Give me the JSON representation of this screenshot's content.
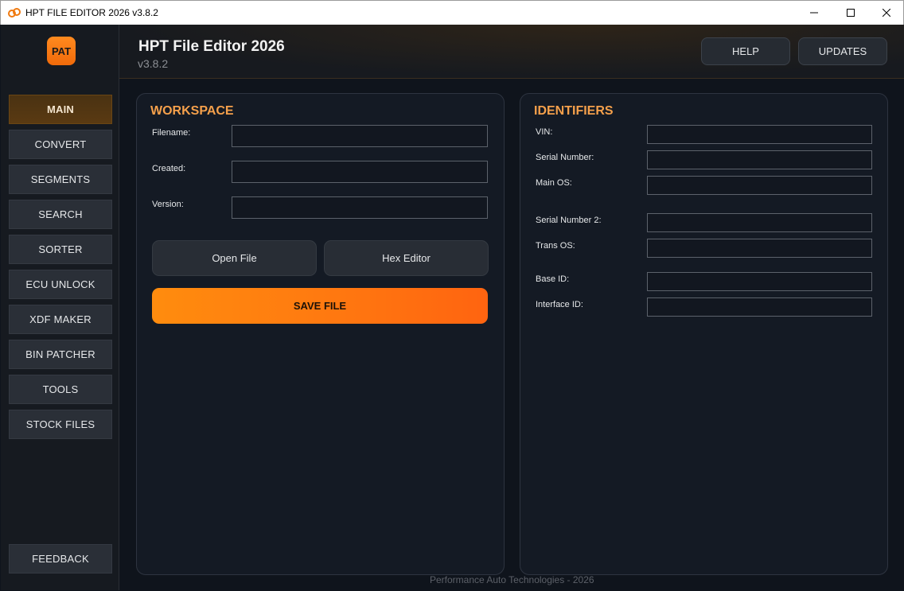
{
  "window": {
    "title": "HPT FILE EDITOR 2026 v3.8.2",
    "icons": {
      "app": "app-logo-icon",
      "minimize": "minimize-icon",
      "maximize": "maximize-icon",
      "close": "close-icon"
    }
  },
  "brand": {
    "logo_text": "PAT",
    "accent": "#ff8a1f"
  },
  "sidebar": {
    "items": [
      {
        "label": "MAIN",
        "active": true
      },
      {
        "label": "CONVERT"
      },
      {
        "label": "SEGMENTS"
      },
      {
        "label": "SEARCH"
      },
      {
        "label": "SORTER"
      },
      {
        "label": "ECU UNLOCK"
      },
      {
        "label": "XDF MAKER"
      },
      {
        "label": "BIN PATCHER"
      },
      {
        "label": "TOOLS"
      },
      {
        "label": "STOCK FILES"
      }
    ],
    "feedback_label": "FEEDBACK"
  },
  "header": {
    "title": "HPT File Editor 2026",
    "version": "v3.8.2",
    "help_label": "HELP",
    "updates_label": "UPDATES"
  },
  "workspace": {
    "title": "WORKSPACE",
    "fields": [
      {
        "label": "Filename:",
        "value": ""
      },
      {
        "label": "Created:",
        "value": ""
      },
      {
        "label": "Version:",
        "value": ""
      }
    ],
    "open_file_label": "Open File",
    "hex_editor_label": "Hex Editor",
    "save_file_label": "SAVE FILE"
  },
  "identifiers": {
    "title": "IDENTIFIERS",
    "fields": [
      {
        "label": "VIN:",
        "value": ""
      },
      {
        "label": "Serial Number:",
        "value": ""
      },
      {
        "label": "Main OS:",
        "value": ""
      },
      {
        "label": "Serial Number 2:",
        "value": ""
      },
      {
        "label": "Trans OS:",
        "value": ""
      },
      {
        "label": "Base ID:",
        "value": ""
      },
      {
        "label": "Interface ID:",
        "value": ""
      }
    ]
  },
  "footer": {
    "text": "Performance Auto Technologies - 2026"
  }
}
